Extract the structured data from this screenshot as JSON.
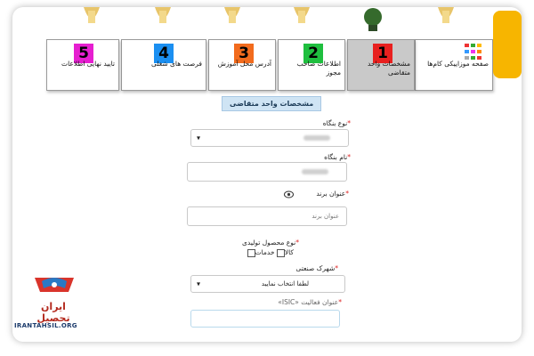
{
  "steps": [
    {
      "label": "صفحه موزاییکی کام‌ها",
      "number": ""
    },
    {
      "label": "مشخصات واحد متقاضی",
      "number": "1",
      "color": "#e8201f"
    },
    {
      "label": "اطلاعات صاحب مجوز",
      "number": "2",
      "color": "#1fbf3f"
    },
    {
      "label": "آدرس محل آموزش",
      "number": "3",
      "color": "#f26b1d"
    },
    {
      "label": "فرصت های شغلی",
      "number": "4",
      "color": "#1b8ff1"
    },
    {
      "label": "تایید نهایی اطلاعات",
      "number": "5",
      "color": "#e61ed0"
    }
  ],
  "page_title": "مشخصات واحد متقاضی",
  "form": {
    "unit_type": {
      "label": "نوع بنگاه",
      "required": "*"
    },
    "unit_name": {
      "label": "نام بنگاه",
      "required": "*"
    },
    "brand_name": {
      "label": "عنوان برند",
      "required": "*",
      "placeholder": "عنوان برند"
    },
    "product_type": {
      "label": "نوع محصول تولیدی",
      "required": "*",
      "options": [
        "کالا",
        "خدمات"
      ]
    },
    "industrial_town": {
      "label": "شهرک صنعتی",
      "required": "*",
      "selected": "لطفا انتخاب نمایید"
    },
    "isic": {
      "label": "عنوان فعالیت «ISIC»",
      "required": "*"
    }
  },
  "logo": {
    "name": "ایران تحصیل",
    "url_text": "IRANTAHSIL.ORG"
  },
  "colors": {
    "accent": "#f7b500",
    "title_bg": "#cfe4f4"
  }
}
